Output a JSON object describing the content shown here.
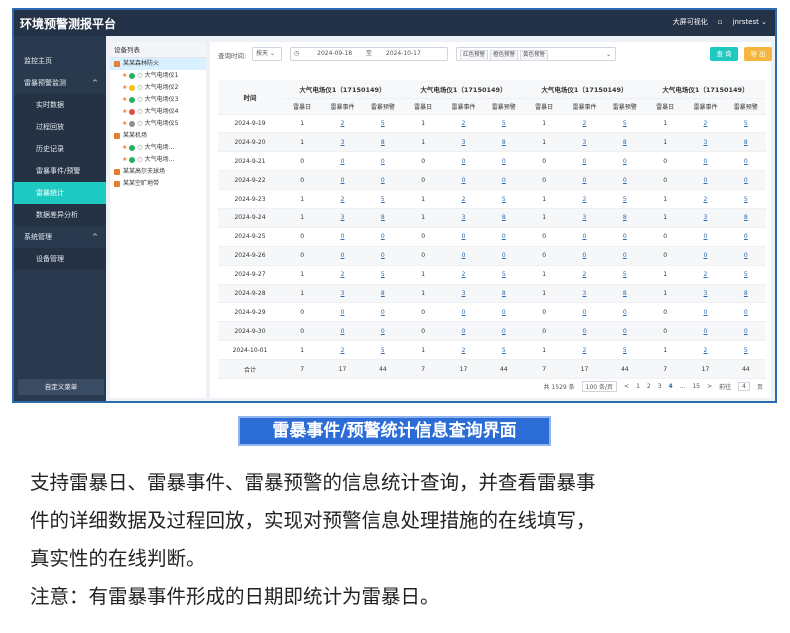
{
  "app": {
    "title": "环境预警测报平台",
    "big_screen": "大屏可视化",
    "user": "jnrstest"
  },
  "sidebar": {
    "items": [
      {
        "label": "监控主页",
        "type": "top"
      },
      {
        "label": "雷暴预警监测",
        "type": "top"
      },
      {
        "label": "实时数据",
        "type": "sub"
      },
      {
        "label": "过程回放",
        "type": "sub"
      },
      {
        "label": "历史记录",
        "type": "sub"
      },
      {
        "label": "雷暴事件/预警",
        "type": "sub"
      },
      {
        "label": "雷暴统计",
        "type": "sub",
        "active": true
      },
      {
        "label": "数据差异分析",
        "type": "sub"
      },
      {
        "label": "系统管理",
        "type": "top"
      },
      {
        "label": "设备管理",
        "type": "sub"
      }
    ],
    "custom_menu": "自定义菜单"
  },
  "device_panel": {
    "header": "设备列表",
    "groups": [
      {
        "label": "某某森林防火",
        "selected": true,
        "devices": [
          {
            "name": "大气电场仪1",
            "color": "#27ae60"
          },
          {
            "name": "大气电场仪2",
            "color": "#f1c40f"
          },
          {
            "name": "大气电场仪3",
            "color": "#27ae60"
          },
          {
            "name": "大气电场仪4",
            "color": "#e74c3c"
          },
          {
            "name": "大气电场仪5",
            "color": "#8a8f96"
          }
        ]
      },
      {
        "label": "某某机场",
        "selected": false,
        "devices": [
          {
            "name": "大气电场...",
            "color": "#27ae60"
          },
          {
            "name": "大气电场...",
            "color": "#27ae60"
          }
        ]
      },
      {
        "label": "某某高尔夫球场",
        "selected": false,
        "devices": []
      },
      {
        "label": "某某空旷地带",
        "selected": false,
        "devices": []
      }
    ]
  },
  "query": {
    "label": "查询时间:",
    "period": "按天",
    "start": "2024-09-18",
    "to": "至",
    "end": "2024-10-17",
    "tags": [
      "红色预警",
      "橙色预警",
      "黄色预警"
    ],
    "query_btn": "查 询",
    "export_btn": "导 出",
    "colors": {
      "query": "#1ec9c1",
      "export": "#f4b63f"
    }
  },
  "table": {
    "time_header": "时间",
    "devices": [
      "大气电场仪1（17150149）",
      "大气电场仪1（17150149）",
      "大气电场仪1（17150149）",
      "大气电场仪1（17150149）"
    ],
    "sub_headers": [
      "雷暴日",
      "雷暴事件",
      "雷暴预警"
    ],
    "rows": [
      {
        "date": "2024-9-19",
        "v": [
          "1",
          "2",
          "5"
        ]
      },
      {
        "date": "2024-9-20",
        "v": [
          "1",
          "3",
          "8"
        ]
      },
      {
        "date": "2024-9-21",
        "v": [
          "0",
          "0",
          "0"
        ]
      },
      {
        "date": "2024-9-22",
        "v": [
          "0",
          "0",
          "0"
        ]
      },
      {
        "date": "2024-9-23",
        "v": [
          "1",
          "2",
          "5"
        ]
      },
      {
        "date": "2024-9-24",
        "v": [
          "1",
          "3",
          "8"
        ]
      },
      {
        "date": "2024-9-25",
        "v": [
          "0",
          "0",
          "0"
        ]
      },
      {
        "date": "2024-9-26",
        "v": [
          "0",
          "0",
          "0"
        ]
      },
      {
        "date": "2024-9-27",
        "v": [
          "1",
          "2",
          "5"
        ]
      },
      {
        "date": "2024-9-28",
        "v": [
          "1",
          "3",
          "8"
        ]
      },
      {
        "date": "2024-9-29",
        "v": [
          "0",
          "0",
          "0"
        ]
      },
      {
        "date": "2024-9-30",
        "v": [
          "0",
          "0",
          "0"
        ]
      },
      {
        "date": "2024-10-01",
        "v": [
          "1",
          "2",
          "5"
        ]
      }
    ],
    "sum_label": "合计",
    "sum": [
      "7",
      "17",
      "44"
    ]
  },
  "pager": {
    "total": "共 1529 条",
    "page_size": "100 条/页",
    "pages": [
      "1",
      "2",
      "3",
      "4",
      "...",
      "15"
    ],
    "current": "4",
    "goto_label": "前往",
    "goto_value": "4",
    "page_suffix": "页"
  },
  "caption": "雷暴事件/预警统计信息查询界面",
  "description": {
    "line1": "支持雷暴日、雷暴事件、雷暴预警的信息统计查询，并查看雷暴事",
    "line2": "件的详细数据及过程回放，实现对预警信息处理措施的在线填写，",
    "line3": "真实性的在线判断。",
    "line4": "注意：有雷暴事件形成的日期即统计为雷暴日。"
  }
}
